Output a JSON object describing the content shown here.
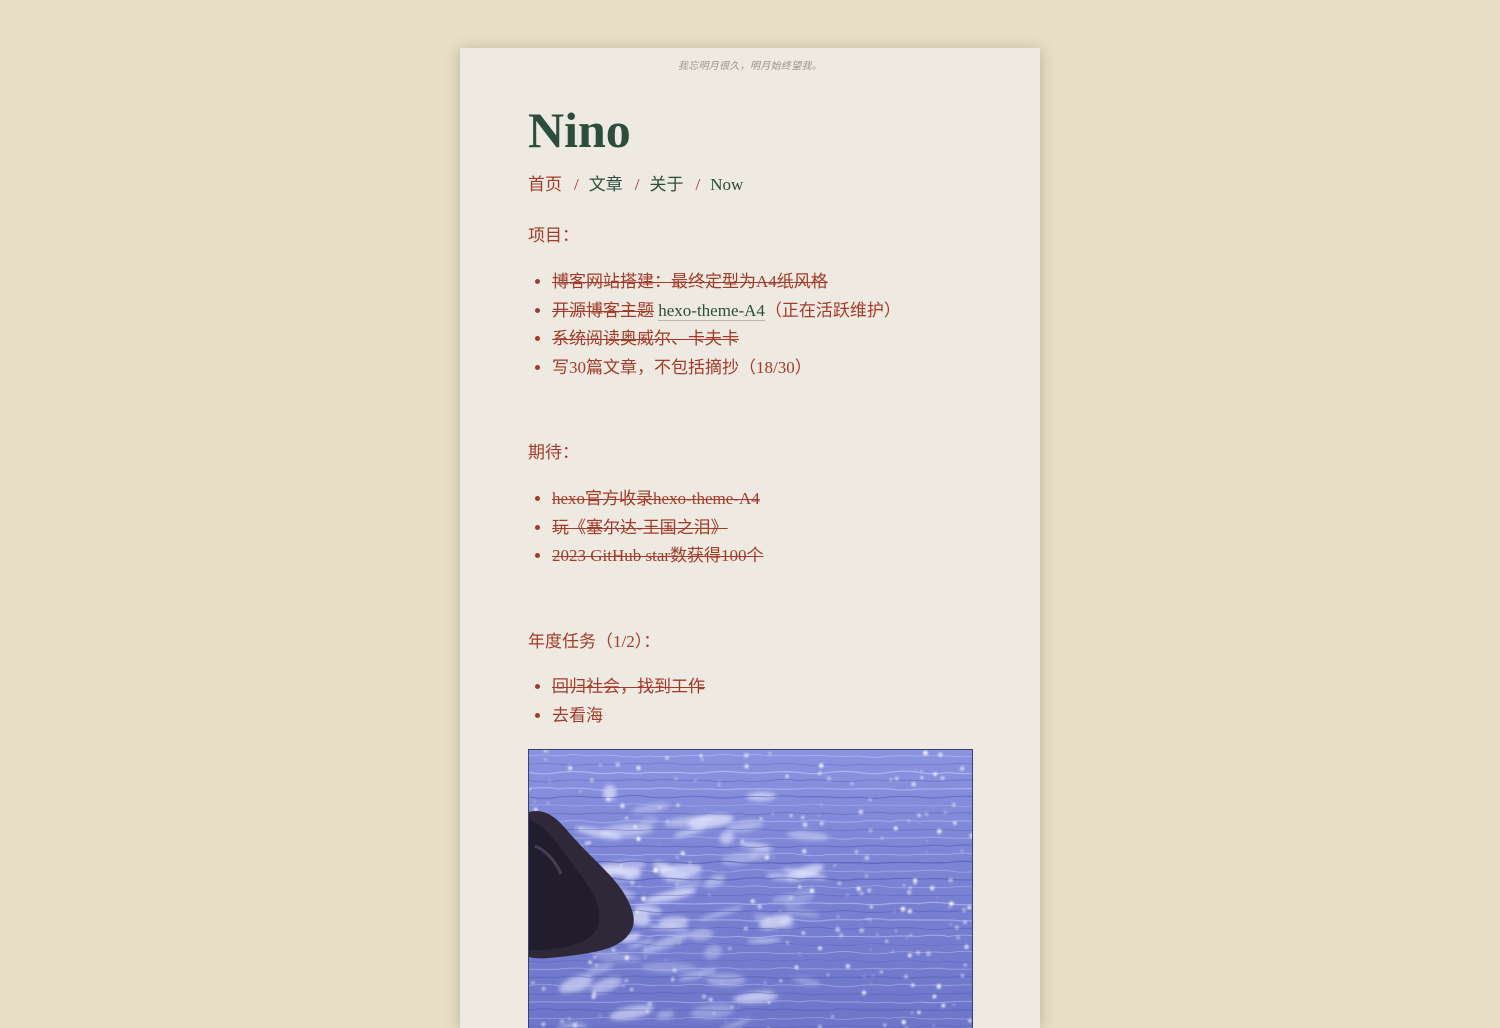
{
  "motto": "我忘明月很久，明月始终望我。",
  "site": {
    "title": "Nino"
  },
  "nav": {
    "items": [
      {
        "label": "首页",
        "active": true
      },
      {
        "label": "文章",
        "active": false
      },
      {
        "label": "关于",
        "active": false
      },
      {
        "label": "Now",
        "active": false
      }
    ],
    "separator": "/"
  },
  "sections": {
    "projects": {
      "title": "项目：",
      "items": [
        {
          "text": "博客网站搭建：最终定型为A4纸风格",
          "done": true
        },
        {
          "prefix": "开源博客主题",
          "link": "hexo-theme-A4",
          "suffix": "（正在活跃维护）",
          "done": true
        },
        {
          "text": "系统阅读奥威尔、卡夫卡",
          "done": true
        },
        {
          "text": "写30篇文章，不包括摘抄（18/30）",
          "done": false
        }
      ]
    },
    "expectations": {
      "title": "期待：",
      "items": [
        {
          "text": "hexo官方收录hexo-theme-A4",
          "done": true
        },
        {
          "text": "玩《塞尔达-王国之泪》",
          "done": true
        },
        {
          "text": "2023 GitHub star数获得100个",
          "done": true
        }
      ]
    },
    "annual": {
      "title": "年度任务（1/2）：",
      "items": [
        {
          "text": "回归社会，找到工作",
          "done": true
        },
        {
          "text": "去看海",
          "done": false
        }
      ]
    }
  },
  "image": {
    "subject": "sea-waves-photo"
  },
  "colors": {
    "background": "#e8dfc6",
    "paper": "#eee9e1",
    "title": "#2c4d3b",
    "accent": "#a13c2a",
    "link": "#2c4d3b",
    "sea": "#7d86d8"
  }
}
